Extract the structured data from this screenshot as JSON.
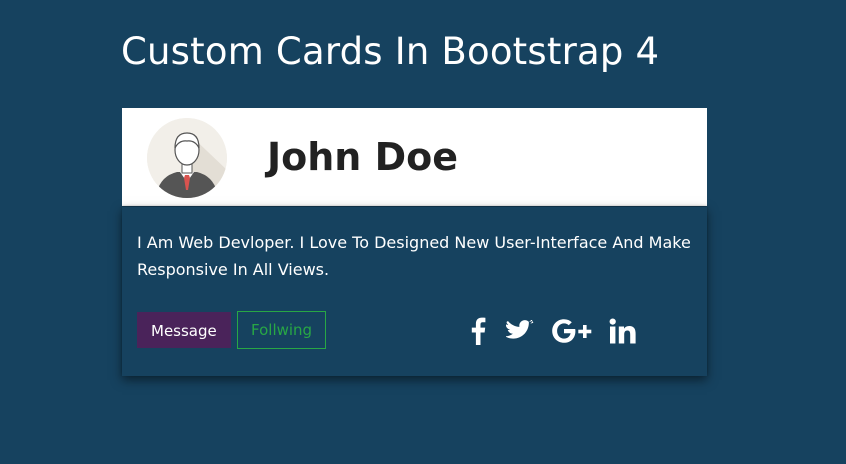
{
  "page": {
    "title": "Custom Cards In Bootstrap 4",
    "background": "#16425f"
  },
  "card": {
    "avatar_icon": "user-avatar-icon",
    "name": "John Doe",
    "bio": "I Am Web Devloper. I Love To Designed New User-Interface And Make Responsive In All Views.",
    "buttons": {
      "message_label": "Message",
      "following_label": "Follwing"
    },
    "social": [
      {
        "icon": "facebook-icon"
      },
      {
        "icon": "twitter-icon"
      },
      {
        "icon": "google-plus-icon"
      },
      {
        "icon": "linkedin-icon"
      }
    ],
    "colors": {
      "header_bg": "#ffffff",
      "body_bg": "#16425f",
      "message_button_bg": "#4a235a",
      "following_button_accent": "#28a745"
    }
  }
}
